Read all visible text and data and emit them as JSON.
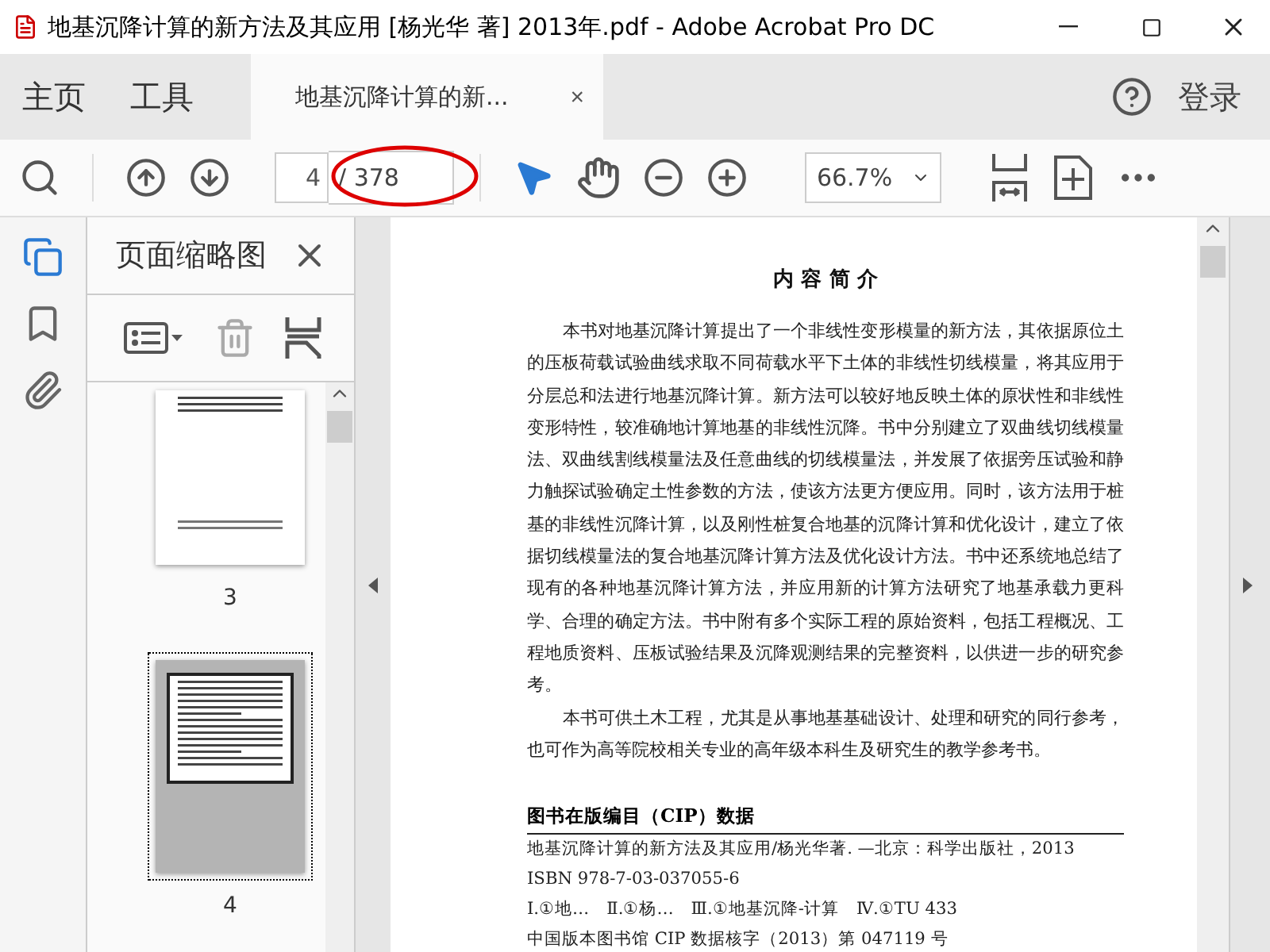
{
  "window": {
    "title": "地基沉降计算的新方法及其应用 [杨光华 著] 2013年.pdf - Adobe Acrobat Pro DC"
  },
  "nav": {
    "items": [
      {
        "label": "主页"
      },
      {
        "label": "工具"
      }
    ],
    "tab": {
      "label": "地基沉降计算的新...",
      "close": "×",
      "selected": true
    },
    "signin": "登录"
  },
  "toolbar": {
    "page_value": "4",
    "page_total": "/ 378",
    "zoom": "66.7%"
  },
  "side_rail": [
    {
      "kind": "pages",
      "selected": true
    },
    {
      "kind": "bookmark",
      "selected": false
    },
    {
      "kind": "attachment",
      "selected": false
    }
  ],
  "thumbnails_panel": {
    "title": "页面缩略图",
    "pages": [
      {
        "label": "3",
        "selected": false
      },
      {
        "label": "4",
        "selected": true
      }
    ]
  },
  "document": {
    "heading": "内 容 简 介",
    "paragraphs": [
      "本书对地基沉降计算提出了一个非线性变形模量的新方法，其依据原位土的压板荷载试验曲线求取不同荷载水平下土体的非线性切线模量，将其应用于分层总和法进行地基沉降计算。新方法可以较好地反映土体的原状性和非线性变形特性，较准确地计算地基的非线性沉降。书中分别建立了双曲线切线模量法、双曲线割线模量法及任意曲线的切线模量法，并发展了依据旁压试验和静力触探试验确定土性参数的方法，使该方法更方便应用。同时，该方法用于桩基的非线性沉降计算，以及刚性桩复合地基的沉降计算和优化设计，建立了依据切线模量法的复合地基沉降计算方法及优化设计方法。书中还系统地总结了现有的各种地基沉降计算方法，并应用新的计算方法研究了地基承载力更科学、合理的确定方法。书中附有多个实际工程的原始资料，包括工程概况、工程地质资料、压板试验结果及沉降观测结果的完整资料，以供进一步的研究参考。",
      "本书可供土木工程，尤其是从事地基基础设计、处理和研究的同行参考，也可作为高等院校相关专业的高年级本科生及研究生的教学参考书。"
    ],
    "cip": {
      "title": "图书在版编目（CIP）数据",
      "lines": [
        "地基沉降计算的新方法及其应用/杨光华著. —北京：科学出版社，2013",
        "ISBN 978-7-03-037055-6",
        "Ⅰ.①地…　Ⅱ.①杨…　Ⅲ.①地基沉降-计算　Ⅳ.①TU 433"
      ],
      "footer": "中国版本图书馆 CIP 数据核字（2013）第 047119 号"
    }
  }
}
